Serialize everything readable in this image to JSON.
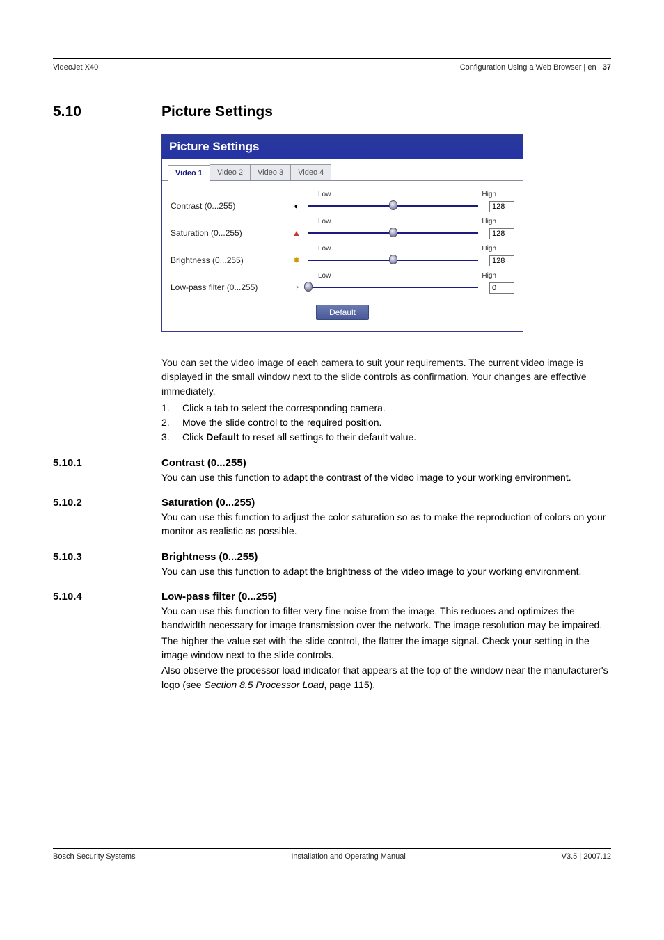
{
  "header": {
    "left": "VideoJet X40",
    "right_prefix": "Configuration Using a Web Browser | en",
    "page_num": "37"
  },
  "section": {
    "num": "5.10",
    "title": "Picture Settings"
  },
  "panel": {
    "title": "Picture Settings",
    "tabs": [
      "Video 1",
      "Video 2",
      "Video 3",
      "Video 4"
    ],
    "low": "Low",
    "high": "High",
    "controls": [
      {
        "label": "Contrast (0...255)",
        "value": "128",
        "pos": 50,
        "icon": "◐",
        "iconColor": "#000"
      },
      {
        "label": "Saturation (0...255)",
        "value": "128",
        "pos": 50,
        "icon": "▲",
        "iconColor": "#c33"
      },
      {
        "label": "Brightness (0...255)",
        "value": "128",
        "pos": 50,
        "icon": "✸",
        "iconColor": "#cc9900"
      },
      {
        "label": "Low-pass filter (0...255)",
        "value": "0",
        "pos": 0,
        "icon": "◔",
        "iconColor": "#357"
      }
    ],
    "default_btn": "Default"
  },
  "intro": {
    "p": "You can set the video image of each camera to suit your requirements. The current video image is displayed in the small window next to the slide controls as confirmation. Your changes are effective immediately.",
    "steps": [
      "Click a tab to select the corresponding camera.",
      "Move the slide control to the required position."
    ],
    "step3_pre": "Click ",
    "step3_bold": "Default",
    "step3_post": " to reset all settings to their default value."
  },
  "subs": [
    {
      "num": "5.10.1",
      "title": "Contrast (0...255)",
      "text": "You can use this function to adapt the contrast of the video image to your working environment."
    },
    {
      "num": "5.10.2",
      "title": "Saturation (0...255)",
      "text": "You can use this function to adjust the color saturation so as to make the reproduction of colors on your monitor as realistic as possible."
    },
    {
      "num": "5.10.3",
      "title": "Brightness (0...255)",
      "text": "You can use this function to adapt the brightness of the video image to your working environment."
    }
  ],
  "sub4": {
    "num": "5.10.4",
    "title": "Low-pass filter (0...255)",
    "p1": "You can use this function to filter very fine noise from the image. This reduces and optimizes the bandwidth necessary for image transmission over the network. The image resolution may be impaired.",
    "p2": "The higher the value set with the slide control, the flatter the image signal. Check your setting in the image window next to the slide controls.",
    "p3_pre": "Also observe the processor load indicator that appears at the top of the window near the manufacturer's logo (see ",
    "p3_ital": "Section 8.5 Processor Load",
    "p3_post": ", page 115)."
  },
  "footer": {
    "left": "Bosch Security Systems",
    "center": "Installation and Operating Manual",
    "right": "V3.5 | 2007.12"
  }
}
